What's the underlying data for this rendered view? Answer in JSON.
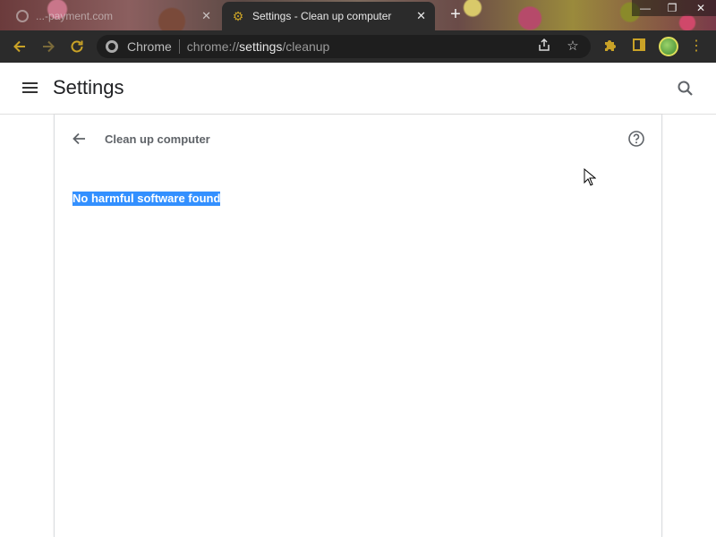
{
  "browser": {
    "tabs": [
      {
        "title": "...-payment.com",
        "active": false
      },
      {
        "title": "Settings - Clean up computer",
        "active": true
      }
    ],
    "new_tab_label": "+",
    "window_controls": {
      "minimize": "—",
      "restore": "❐",
      "close": "✕"
    },
    "omnibox": {
      "site_label": "Chrome",
      "url_prefix": "chrome://",
      "url_host": "settings",
      "url_path": "/cleanup"
    },
    "accent_color": "#c9a227"
  },
  "settings": {
    "title": "Settings"
  },
  "cleanup": {
    "title": "Clean up computer",
    "result": "No harmful software found",
    "highlight_color": "#3390ff"
  },
  "icons": {
    "menu": "hamburger-icon",
    "search": "search-icon",
    "back": "back-arrow-icon",
    "help": "help-icon",
    "reload": "reload-icon",
    "share": "share-icon",
    "bookmark": "star-icon",
    "extensions": "puzzle-icon",
    "sidepanel": "side-panel-icon"
  }
}
